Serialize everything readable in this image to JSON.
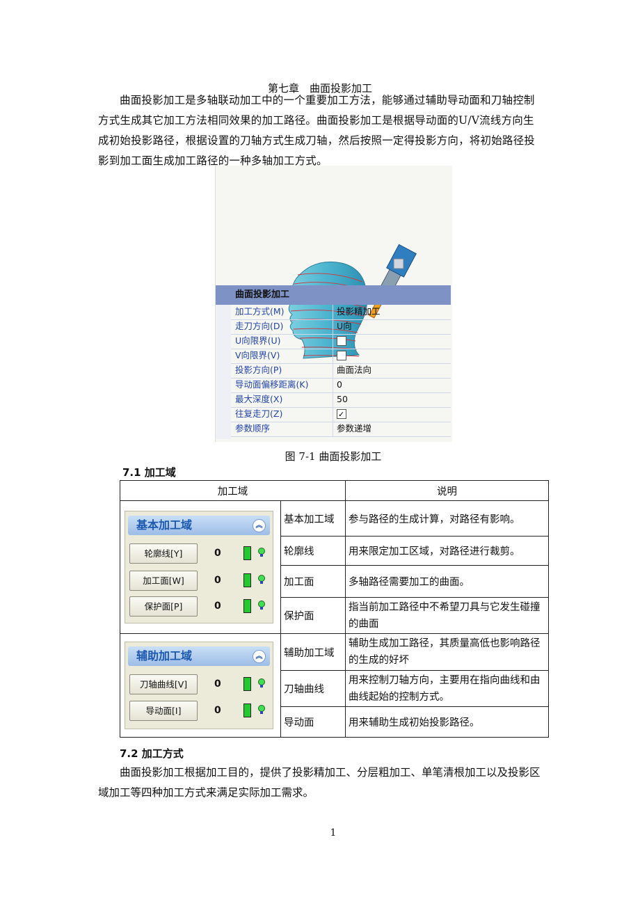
{
  "chapter_title": "第七章　曲面投影加工",
  "intro": "曲面投影加工是多轴联动加工中的一个重要加工方法，能够通过辅助导动面和刀轴控制方式生成其它加工方法相同效果的加工路径。曲面投影加工是根据导动面的U/V流线方向生成初始投影路径，根据设置的刀轴方式生成刀轴，然后按照一定得投影方向，将初始路径投影到加工面生成加工路径的一种多轴加工方式。",
  "figure": {
    "panel_title": "曲面投影加工",
    "rows": [
      {
        "key": "加工方式(M)",
        "value": "投影精加工"
      },
      {
        "key": "走刀方向(D)",
        "value": "U向"
      },
      {
        "key": "U向限界(U)",
        "value": ""
      },
      {
        "key": "V向限界(V)",
        "value": ""
      },
      {
        "key": "投影方向(P)",
        "value": "曲面法向"
      },
      {
        "key": "导动面偏移距离(K)",
        "value": "0"
      },
      {
        "key": "最大深度(X)",
        "value": "50"
      },
      {
        "key": "往复走刀(Z)",
        "value": ""
      },
      {
        "key": "参数顺序",
        "value": "参数递增"
      }
    ],
    "checkboxes": {
      "u_limit": false,
      "v_limit": false,
      "reciprocate": true
    },
    "caption": "图 7-1 曲面投影加工"
  },
  "section71": "7.1 加工域",
  "table": {
    "header_left": "加工域",
    "header_right": "说明",
    "basic_panel": {
      "title": "基本加工域",
      "buttons": [
        {
          "label": "轮廓线[Y]",
          "count": "0"
        },
        {
          "label": "加工面[W]",
          "count": "0"
        },
        {
          "label": "保护面[P]",
          "count": "0"
        }
      ]
    },
    "aux_panel": {
      "title": "辅助加工域",
      "buttons": [
        {
          "label": "刀轴曲线[V]",
          "count": "0"
        },
        {
          "label": "导动面[I]",
          "count": "0"
        }
      ]
    },
    "rows": [
      {
        "name": "基本加工域",
        "desc": "参与路径的生成计算，对路径有影响。"
      },
      {
        "name": "轮廓线",
        "desc": "用来限定加工区域，对路径进行裁剪。"
      },
      {
        "name": "加工面",
        "desc": "多轴路径需要加工的曲面。"
      },
      {
        "name": "保护面",
        "desc": "指当前加工路径中不希望刀具与它发生碰撞的曲面"
      },
      {
        "name": "辅助加工域",
        "desc": "辅助生成加工路径，其质量高低也影响路径的生成的好坏"
      },
      {
        "name": "刀轴曲线",
        "desc": "用来控制刀轴方向，主要用在指向曲线和由曲线起始的控制方式。"
      },
      {
        "name": "导动面",
        "desc": "用来辅助生成初始投影路径。"
      }
    ]
  },
  "section72": "7.2 加工方式",
  "para72": "曲面投影加工根据加工目的，提供了投影精加工、分层粗加工、单笔清根加工以及投影区域加工等四种加工方式来满足实际加工需求。",
  "page_number": "1"
}
